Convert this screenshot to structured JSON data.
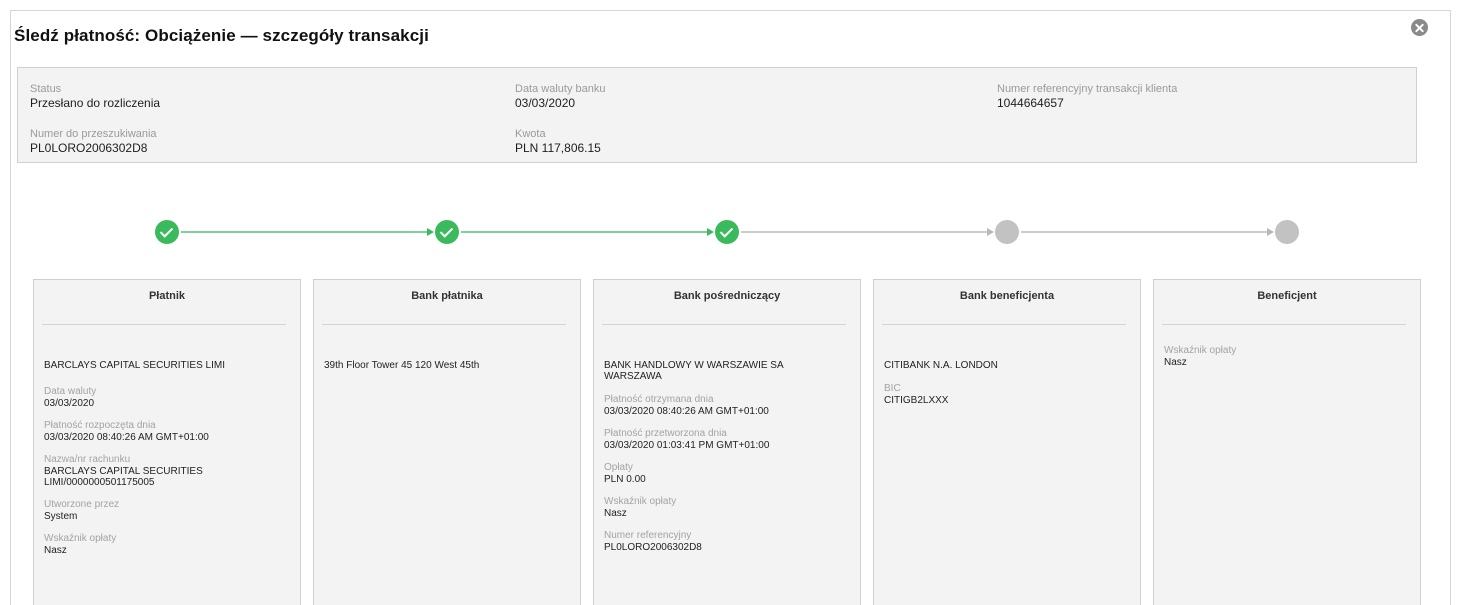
{
  "title": "Śledź płatność: Obciążenie — szczegóły transakcji",
  "summary": {
    "status_label": "Status",
    "status_value": "Przesłano do rozliczenia",
    "value_date_label": "Data waluty banku",
    "value_date_value": "03/03/2020",
    "client_ref_label": "Numer referencyjny transakcji klienta",
    "client_ref_value": "1044664657",
    "search_no_label": "Numer do przeszukiwania",
    "search_no_value": "PL0LORO2006302D8",
    "amount_label": "Kwota",
    "amount_value": "PLN 117,806.15"
  },
  "tracker": {
    "steps": [
      {
        "status": "done"
      },
      {
        "status": "done"
      },
      {
        "status": "done"
      },
      {
        "status": "pending"
      },
      {
        "status": "pending"
      }
    ],
    "colors": {
      "done": "#3bba5d",
      "pending": "#c2c2c2"
    }
  },
  "cards": {
    "payer": {
      "header": "Płatnik",
      "main": "BARCLAYS CAPITAL SECURITIES LIMI",
      "value_date_label": "Data waluty",
      "value_date_value": "03/03/2020",
      "initiated_label": "Płatność rozpoczęta dnia",
      "initiated_value": "03/03/2020 08:40:26 AM GMT+01:00",
      "account_label": "Nazwa/nr rachunku",
      "account_value_1": "BARCLAYS CAPITAL SECURITIES",
      "account_value_2": "LIMI/0000000501175005",
      "created_by_label": "Utworzone przez",
      "created_by_value": "System",
      "fee_label": "Wskaźnik opłaty",
      "fee_value": "Nasz"
    },
    "payer_bank": {
      "header": "Bank płatnika",
      "main": "39th Floor Tower 45 120 West 45th"
    },
    "intermediary_bank": {
      "header": "Bank pośredniczący",
      "main_1": "BANK HANDLOWY W WARSZAWIE SA",
      "main_2": "WARSZAWA",
      "received_label": "Płatność otrzymana dnia",
      "received_value": "03/03/2020 08:40:26 AM GMT+01:00",
      "processed_label": "Płatność przetworzona dnia",
      "processed_value": "03/03/2020 01:03:41 PM GMT+01:00",
      "fees_label": "Opłaty",
      "fees_value": "PLN 0.00",
      "fee_ind_label": "Wskaźnik opłaty",
      "fee_ind_value": "Nasz",
      "ref_label": "Numer referencyjny",
      "ref_value": "PL0LORO2006302D8"
    },
    "beneficiary_bank": {
      "header": "Bank beneficjenta",
      "main": "CITIBANK N.A. LONDON",
      "bic_label": "BIC",
      "bic_value": "CITIGB2LXXX"
    },
    "beneficiary": {
      "header": "Beneficjent",
      "fee_label": "Wskaźnik opłaty",
      "fee_value": "Nasz"
    }
  }
}
